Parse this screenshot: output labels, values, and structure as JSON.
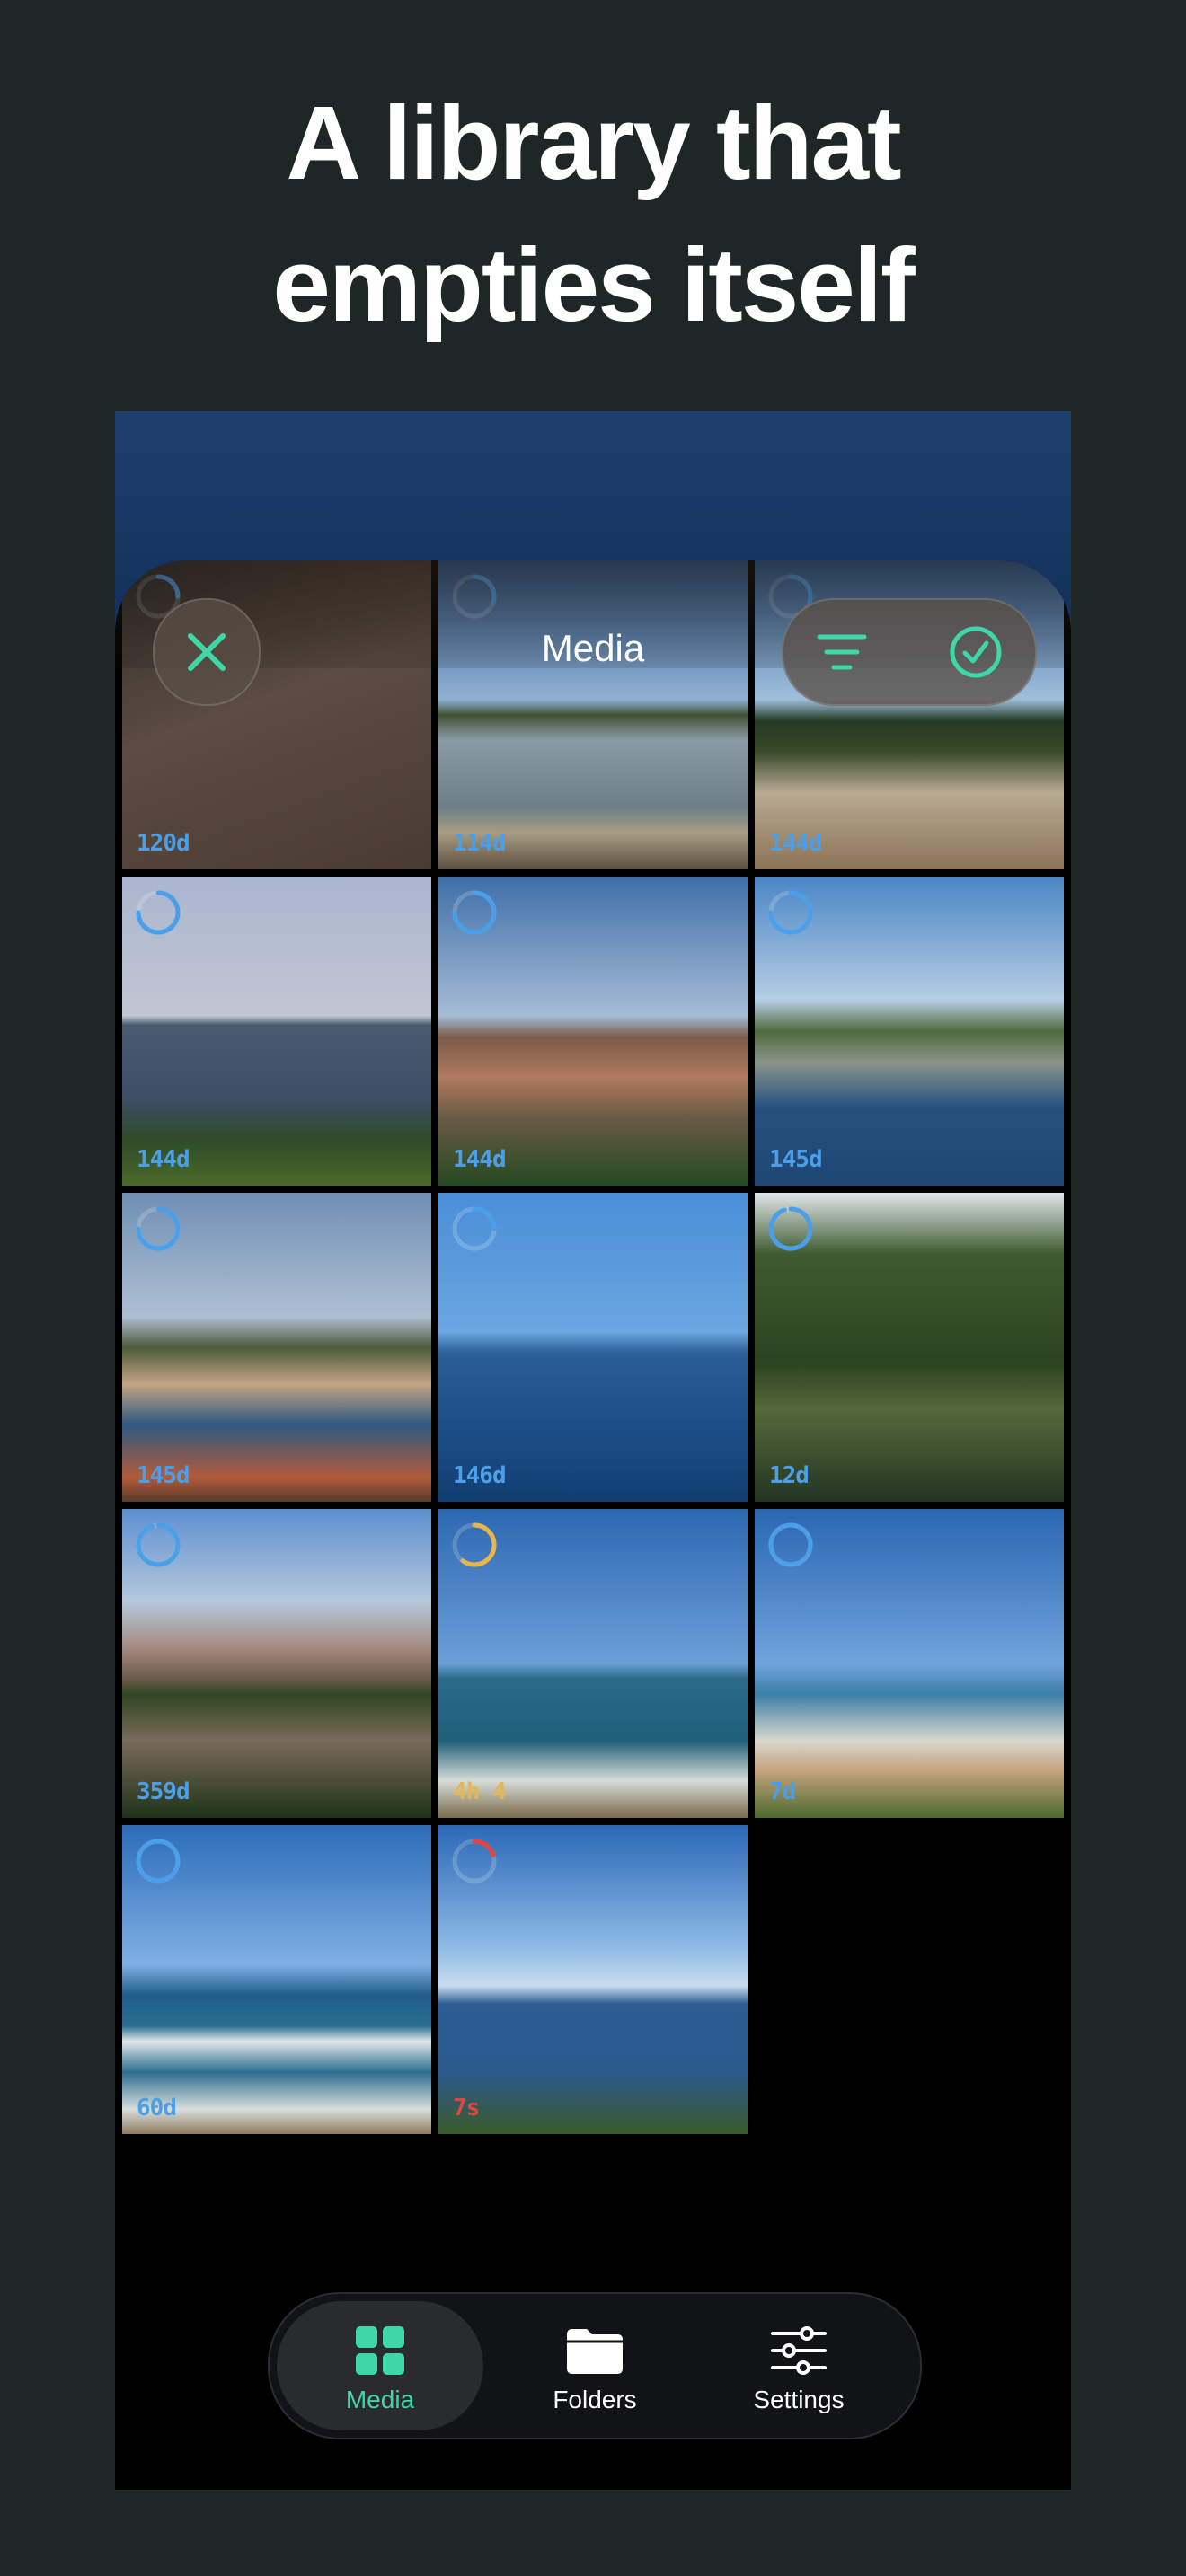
{
  "headline": {
    "line1": "A library that",
    "line2": "empties itself"
  },
  "nav": {
    "title": "Media"
  },
  "accent": "#3fd6a8",
  "tiles": [
    {
      "age": "120d",
      "ring": "blue",
      "ring_fill": 0.25,
      "scene": "dark-interior"
    },
    {
      "age": "114d",
      "ring": "blue",
      "ring_fill": 0.3,
      "scene": "lake"
    },
    {
      "age": "144d",
      "ring": "blue",
      "ring_fill": 0.3,
      "scene": "dunes"
    },
    {
      "age": "144d",
      "ring": "blue",
      "ring_fill": 0.75,
      "scene": "sea-island"
    },
    {
      "age": "144d",
      "ring": "blue",
      "ring_fill": 0.75,
      "scene": "town"
    },
    {
      "age": "145d",
      "ring": "blue",
      "ring_fill": 0.75,
      "scene": "bay"
    },
    {
      "age": "145d",
      "ring": "blue",
      "ring_fill": 0.75,
      "scene": "coast-town"
    },
    {
      "age": "146d",
      "ring": "blue",
      "ring_fill": 0.25,
      "scene": "deep-sea"
    },
    {
      "age": "12d",
      "ring": "blue",
      "ring_fill": 0.95,
      "scene": "trees"
    },
    {
      "age": "359d",
      "ring": "blue",
      "ring_fill": 0.95,
      "scene": "palace"
    },
    {
      "age": "4h 4",
      "ring": "yellow",
      "ring_fill": 0.6,
      "scene": "beach-waves"
    },
    {
      "age": "7d",
      "ring": "blue",
      "ring_fill": 1.0,
      "scene": "beach-town"
    },
    {
      "age": "60d",
      "ring": "blue",
      "ring_fill": 1.0,
      "scene": "surf"
    },
    {
      "age": "7s",
      "ring": "red",
      "ring_fill": 0.2,
      "scene": "cliff-sea",
      "selected": true
    }
  ],
  "tabs": [
    {
      "label": "Media",
      "icon": "grid-icon",
      "active": true
    },
    {
      "label": "Folders",
      "icon": "folder-icon",
      "active": false
    },
    {
      "label": "Settings",
      "icon": "sliders-icon",
      "active": false
    }
  ],
  "colors": {
    "ring_blue": "#4a9fe8",
    "ring_yellow": "#e8b64a",
    "ring_red": "#e0463f"
  }
}
